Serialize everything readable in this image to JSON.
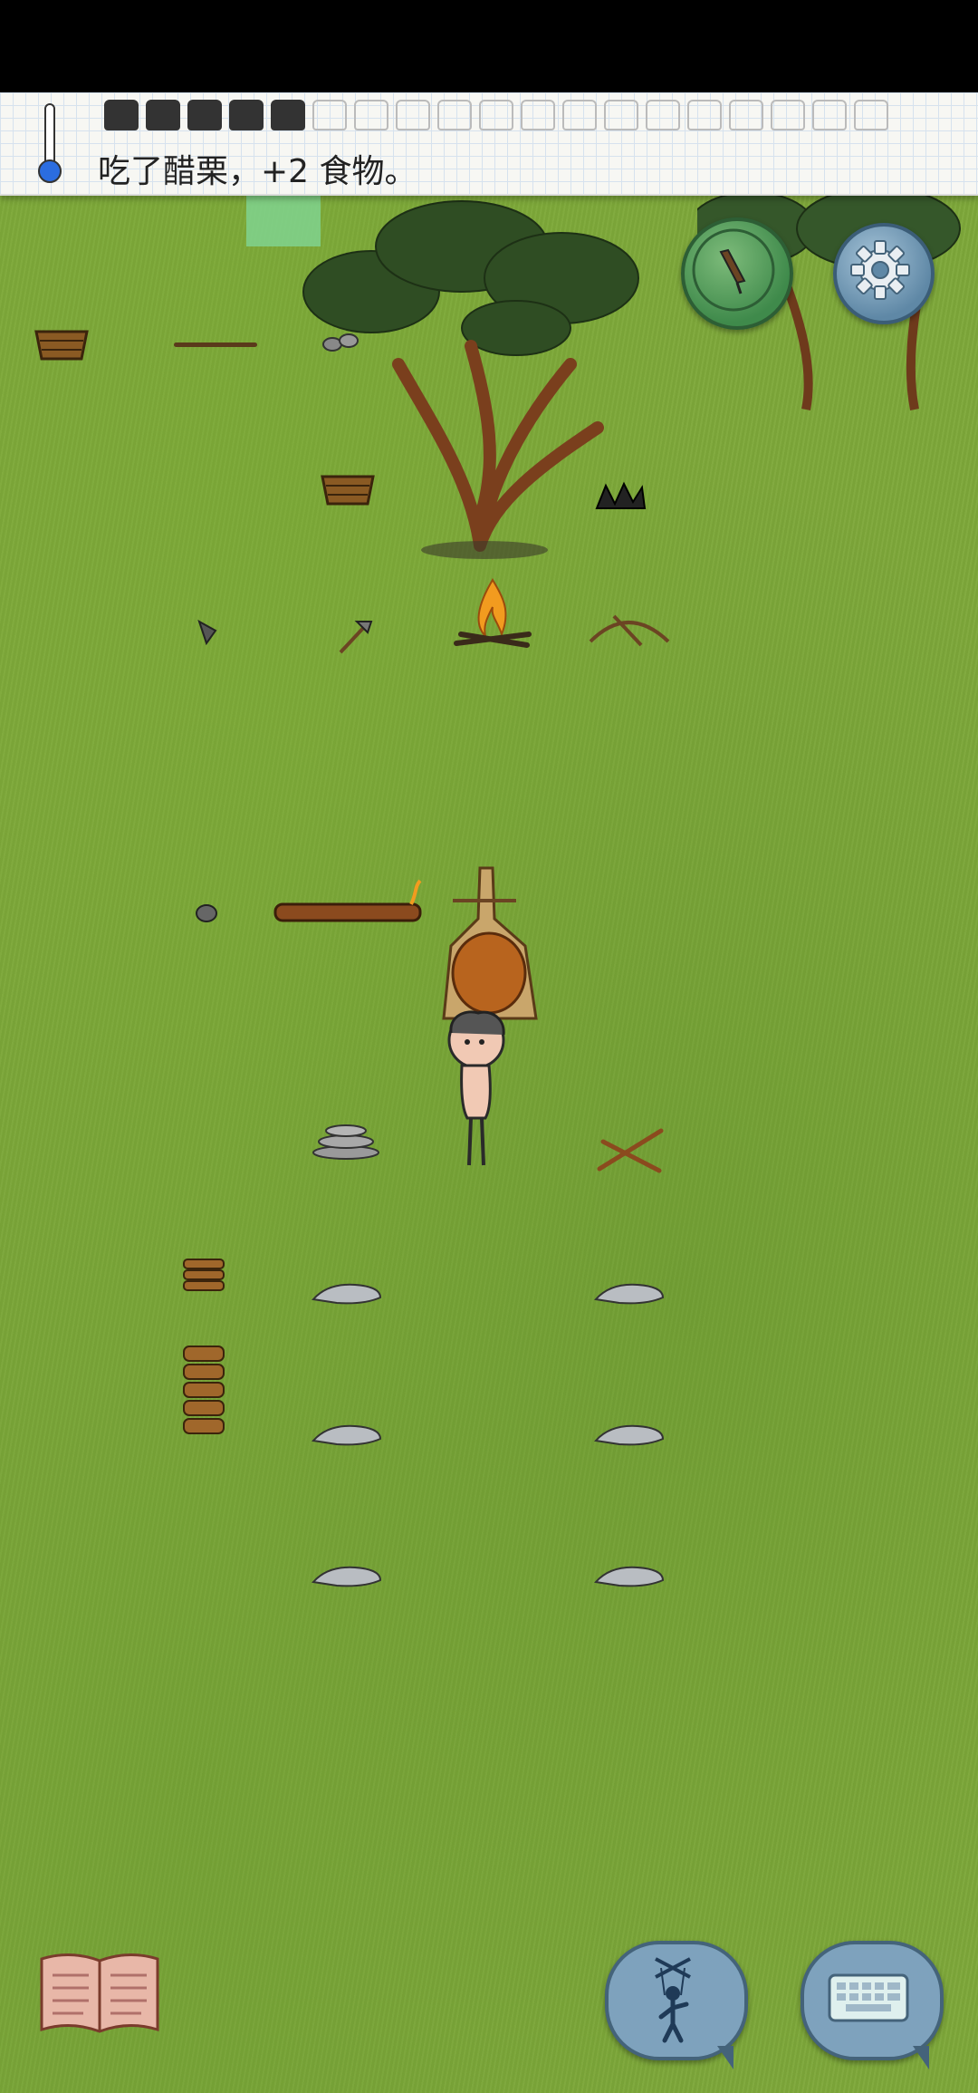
{
  "header": {
    "message": "吃了醋栗，+2 食物。",
    "food_full": 5,
    "food_total": 19
  },
  "buttons": {
    "compass": "compass-icon",
    "settings": "gear-icon",
    "book": "book-icon",
    "puppet": "puppet-icon",
    "keyboard": "keyboard-icon"
  },
  "colors": {
    "grass": "#7ea83a",
    "compass_button": "#3f8a4b",
    "settings_button": "#5f88a6",
    "chat_buttons": "#7ea2bd",
    "thermometer_bulb": "#2b6de0"
  }
}
